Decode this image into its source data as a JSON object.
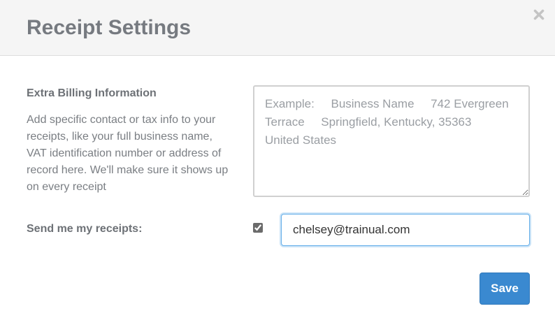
{
  "modal": {
    "title": "Receipt Settings",
    "close_icon": "close-icon"
  },
  "billing": {
    "heading": "Extra Billing Information",
    "description": "Add specific contact or tax info to your receipts, like your full business name, VAT identification number or address of record here. We'll make sure it shows up on every receipt",
    "placeholder": "Example:     Business Name     742 Evergreen Terrace     Springfield, Kentucky, 35363     United States",
    "value": ""
  },
  "receipts": {
    "label": "Send me my receipts:",
    "checked": true,
    "email_value": "chelsey@trainual.com"
  },
  "actions": {
    "save_label": "Save"
  },
  "colors": {
    "primary": "#3a89d0",
    "header_bg": "#f5f5f5",
    "title": "#767a80",
    "focus_border": "#66afe9"
  }
}
